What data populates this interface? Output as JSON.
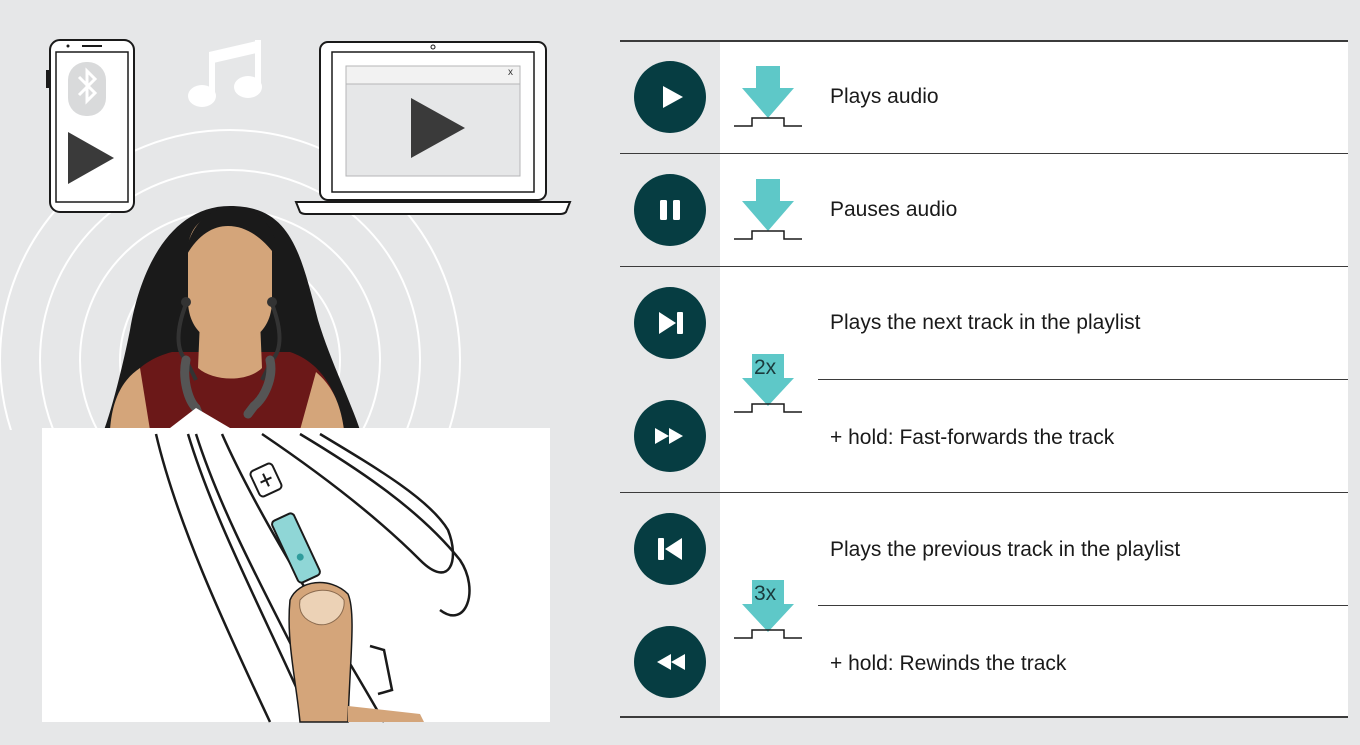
{
  "illustration": {
    "laptop_close_label": "x"
  },
  "rows": [
    {
      "icon": "play-icon",
      "label": "Plays audio"
    },
    {
      "icon": "pause-icon",
      "label": "Pauses audio"
    },
    {
      "icon": "next-track-icon",
      "label": "Plays the next track in the playlist"
    },
    {
      "icon": "fast-forward-icon",
      "label": "+ hold: Fast-forwards the track"
    },
    {
      "icon": "previous-track-icon",
      "label": "Plays the previous track in the playlist"
    },
    {
      "icon": "rewind-icon",
      "label": "+ hold: Rewinds the track"
    }
  ],
  "press_indicators": [
    {
      "count": ""
    },
    {
      "count": ""
    },
    {
      "count": "2x"
    },
    {
      "count": "3x"
    }
  ],
  "colors": {
    "button_bg": "#063d42",
    "press_arrow": "#5ec8c8",
    "page_bg": "#e6e7e8"
  }
}
